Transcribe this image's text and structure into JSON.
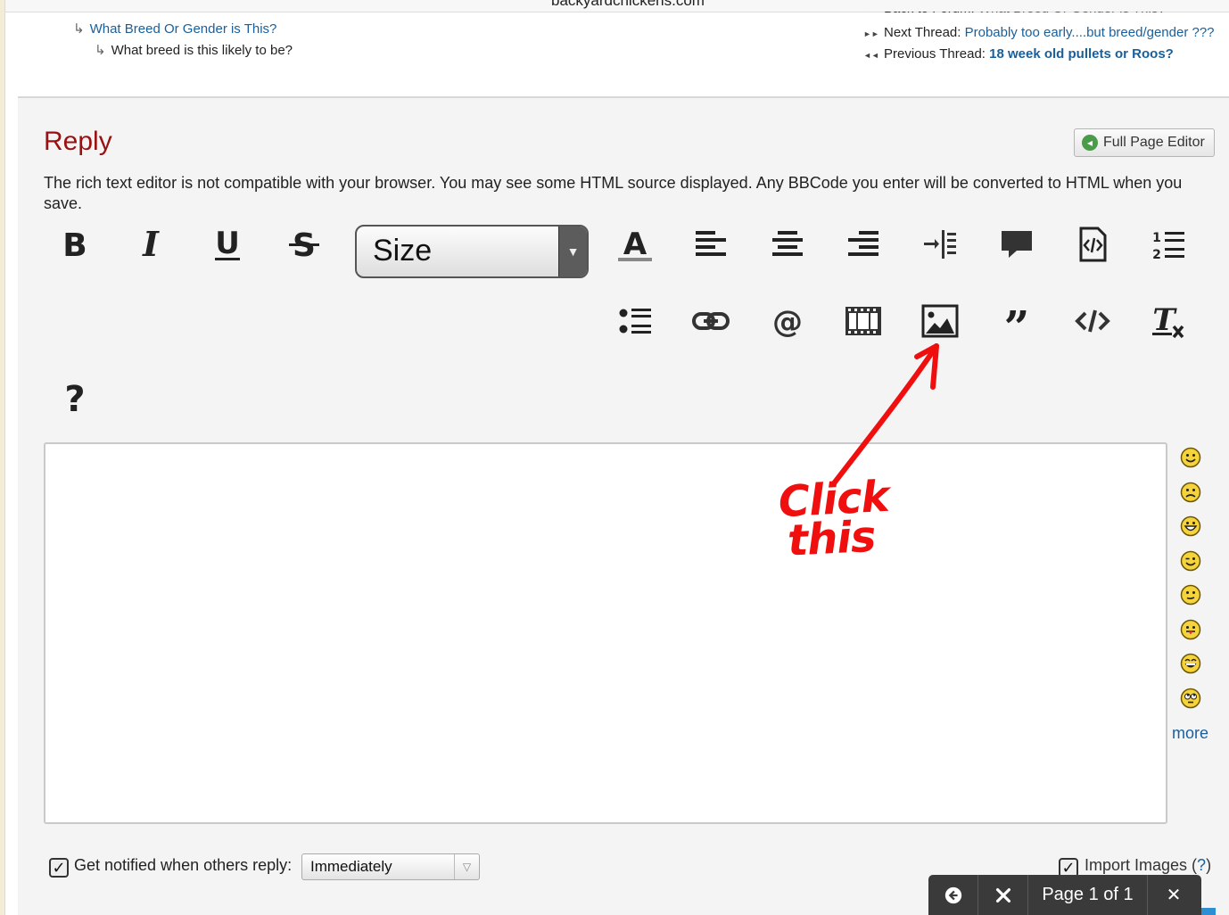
{
  "browser": {
    "domain": "backyardchickens.com"
  },
  "breadcrumbs": [
    {
      "text": "What Breed Or Gender is This?",
      "link": true
    },
    {
      "text": "What breed is this likely to be?",
      "link": false
    }
  ],
  "thread_nav": {
    "partial": {
      "label": "Back to Forum:",
      "value": "What Breed Or Gender is This?"
    },
    "next": {
      "label": "Next Thread:",
      "value": "Probably too early....but breed/gender ???"
    },
    "previous": {
      "label": "Previous Thread:",
      "value": "18 week old pullets or Roos?"
    }
  },
  "reply": {
    "title": "Reply",
    "full_page_editor": "Full Page Editor",
    "notice": "The rich text editor is not compatible with your browser. You may see some HTML source displayed. Any BBCode you enter will be converted to HTML when you save.",
    "size_label": "Size",
    "more": "more",
    "notify_label": "Get notified when others reply:",
    "notify_value": "Immediately",
    "import_images_label": "Import Images",
    "import_help": "?"
  },
  "toolbar_icons": [
    "bold-icon",
    "italic-icon",
    "underline-icon",
    "strikethrough-icon",
    "font-color-icon",
    "align-left-icon",
    "align-center-icon",
    "align-right-icon",
    "indent-icon",
    "comment-icon",
    "source-icon",
    "numbered-list-icon",
    "bullet-list-icon",
    "link-icon",
    "mention-icon",
    "video-icon",
    "image-icon",
    "quote-icon",
    "code-icon",
    "remove-format-icon",
    "help-icon"
  ],
  "annotation": {
    "text_line1": "Click",
    "text_line2": "this",
    "color": "#ef0f0f"
  },
  "pager": {
    "text": "Page 1 of 1"
  },
  "colors": {
    "reply_title": "#9b1010",
    "link": "#1a5f9a"
  }
}
